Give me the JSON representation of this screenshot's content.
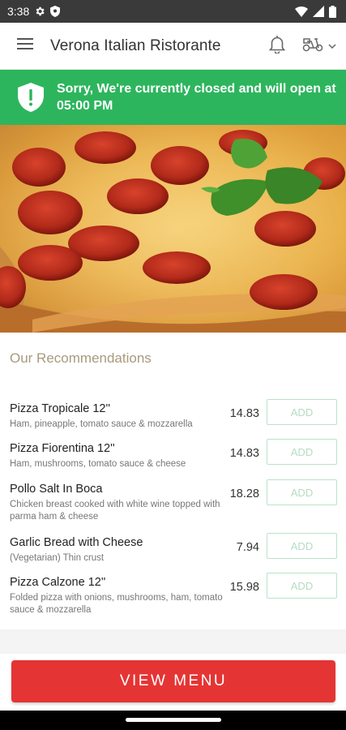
{
  "status_bar": {
    "time": "3:38",
    "icons": [
      "gear-icon",
      "shield-icon",
      "wifi-icon",
      "signal-icon",
      "battery-icon"
    ]
  },
  "app_bar": {
    "title": "Verona Italian Ristorante",
    "icons": [
      "hamburger-menu-icon",
      "bell-icon",
      "scooter-icon",
      "chevron-down-icon"
    ]
  },
  "closed_banner": {
    "message": "Sorry, We're currently closed and will open at 05:00 PM",
    "color": "#2db55d"
  },
  "recommendations": {
    "heading": "Our Recommendations",
    "items": [
      {
        "name": "Pizza Tropicale 12''",
        "description": "Ham, pineapple, tomato sauce & mozzarella",
        "price": "14.83",
        "button": "ADD"
      },
      {
        "name": "Pizza Fiorentina 12''",
        "description": "Ham, mushrooms, tomato sauce & cheese",
        "price": "14.83",
        "button": "ADD"
      },
      {
        "name": "Pollo Salt In Boca",
        "description": "Chicken breast cooked with white wine topped with parma ham & cheese",
        "price": "18.28",
        "button": "ADD"
      },
      {
        "name": "Garlic Bread with Cheese",
        "description": "(Vegetarian) Thin crust",
        "price": "7.94",
        "button": "ADD"
      },
      {
        "name": "Pizza Calzone 12''",
        "description": "Folded pizza with onions, mushrooms, ham, tomato sauce & mozzarella",
        "price": "15.98",
        "button": "ADD"
      }
    ]
  },
  "bottom": {
    "view_menu_label": "VIEW MENU",
    "accent_color": "#e53434"
  }
}
